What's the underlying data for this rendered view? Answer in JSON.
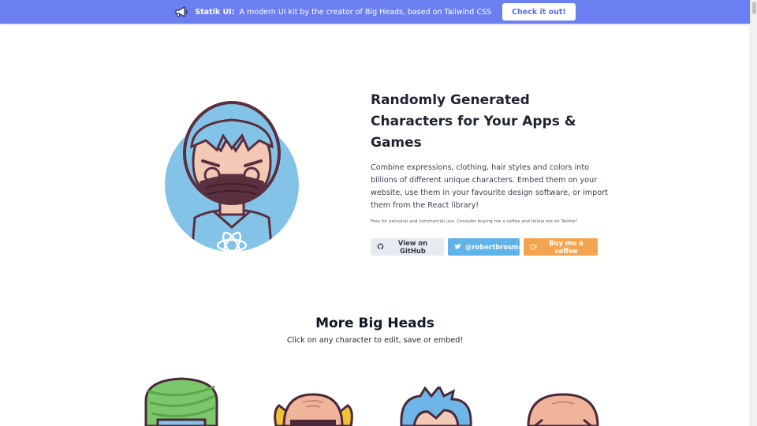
{
  "banner": {
    "icon": "megaphone-icon",
    "brand": "Statik UI:",
    "message": "A modern UI kit by the creator of Big Heads, based on Tailwind CSS",
    "cta_label": "Check it out!",
    "background": "#6c7ff0"
  },
  "hero": {
    "title": "Randomly Generated Characters for Your Apps & Games",
    "description": "Combine expressions, clothing, hair styles and colors into billions of different unique characters. Embed them on your website, use them in your favourite design software, or import them from the React library!",
    "note": "Free for personal and commercial use. Consider buying me a coffee and follow me on Twitter!",
    "buttons": [
      {
        "label": "View on GitHub",
        "icon": "github-icon",
        "color": "#e6ebf1"
      },
      {
        "label": "@robertbrosma",
        "icon": "twitter-icon",
        "color": "#5fb3e8"
      },
      {
        "label": "Buy me a coffee",
        "icon": "coffee-icon",
        "color": "#f4a44e"
      }
    ]
  },
  "more": {
    "title": "More Big Heads",
    "subtitle": "Click on any character to edit, save or embed!",
    "characters": [
      {
        "name": "turban-character"
      },
      {
        "name": "bald-glasses-character"
      },
      {
        "name": "blue-hair-character"
      },
      {
        "name": "bald-character"
      }
    ]
  },
  "colors": {
    "accent": "#6c7ff0",
    "avatar_bg": "#83c3e8",
    "outline": "#5a2f3f"
  }
}
